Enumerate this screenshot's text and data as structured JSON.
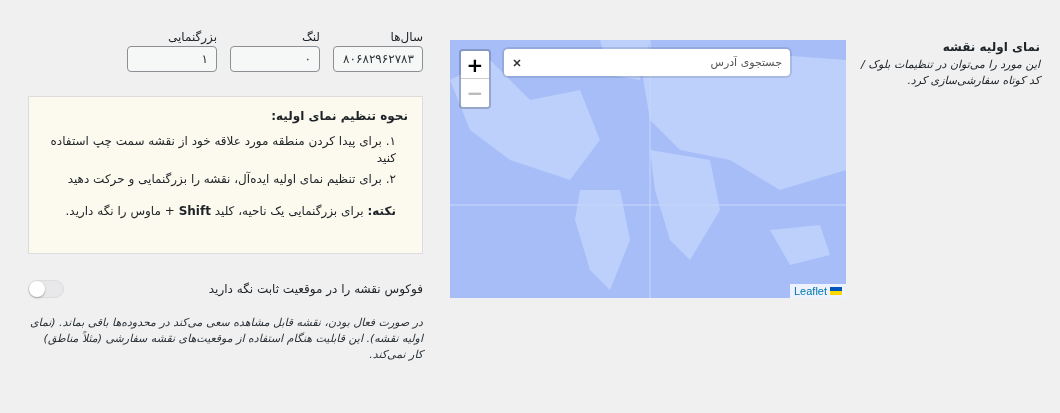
{
  "setting": {
    "title": "نمای اولیه نقشه",
    "description": "این مورد را می‌توان در تنظیمات بلوک / کد کوتاه سفارشی‌سازی کرد."
  },
  "map": {
    "zoom_in": "+",
    "zoom_out": "−",
    "zoom_out_disabled": true,
    "search": {
      "placeholder": "جستجوی آدرس"
    },
    "attribution": "Leaflet"
  },
  "fields": [
    {
      "label": "سال‌ها",
      "value": "۸۰۶۸۲۹۶۲۷۸۳"
    },
    {
      "label": "لنگ",
      "value": "۰"
    },
    {
      "label": "بزرگنمایی",
      "value": "۱"
    }
  ],
  "instructions": {
    "title": "نحوه تنظیم نمای اولیه:",
    "steps": [
      "۱. برای پیدا کردن منطقه مورد علاقه خود از نقشه سمت چپ استفاده کنید",
      "۲. برای تنظیم نمای اولیه ایده‌آل، نقشه را بزرگنمایی و حرکت دهید"
    ],
    "note": "**نکته:** برای بزرگنمایی یک ناحیه، کلید **Shift** + ماوس را نگه دارید."
  },
  "toggle": {
    "label": "فوکوس نقشه را در موقعیت ثابت نگه دارید",
    "on": false
  },
  "help": "در صورت فعال بودن، نقشه قابل مشاهده سعی می‌کند در محدوده‌ها باقی بماند. (نمای اولیه نقشه). این قابلیت هنگام استفاده از موقعیت‌های نقشه سفارشی (مثلاً مناطق) کار نمی‌کند."
}
